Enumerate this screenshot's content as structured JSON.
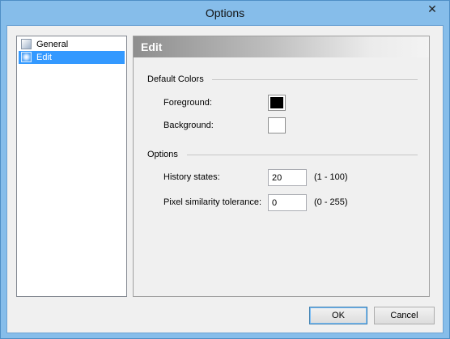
{
  "window": {
    "title": "Options",
    "close_glyph": "✕"
  },
  "nav": {
    "items": [
      {
        "label": "General",
        "icon": "general-page-icon",
        "selected": false
      },
      {
        "label": "Edit",
        "icon": "edit-page-icon",
        "selected": true
      }
    ]
  },
  "panel": {
    "title": "Edit",
    "default_colors": {
      "heading": "Default Colors",
      "foreground_label": "Foreground:",
      "foreground_color": "#000000",
      "background_label": "Background:",
      "background_color": "#ffffff"
    },
    "options": {
      "heading": "Options",
      "history_label": "History states:",
      "history_value": "20",
      "history_range": "(1 - 100)",
      "tolerance_label": "Pixel similarity tolerance:",
      "tolerance_value": "0",
      "tolerance_range": "(0 - 255)"
    }
  },
  "buttons": {
    "ok": "OK",
    "cancel": "Cancel"
  },
  "colors": {
    "selection": "#3399ff",
    "title_bar": "#86bdea"
  }
}
